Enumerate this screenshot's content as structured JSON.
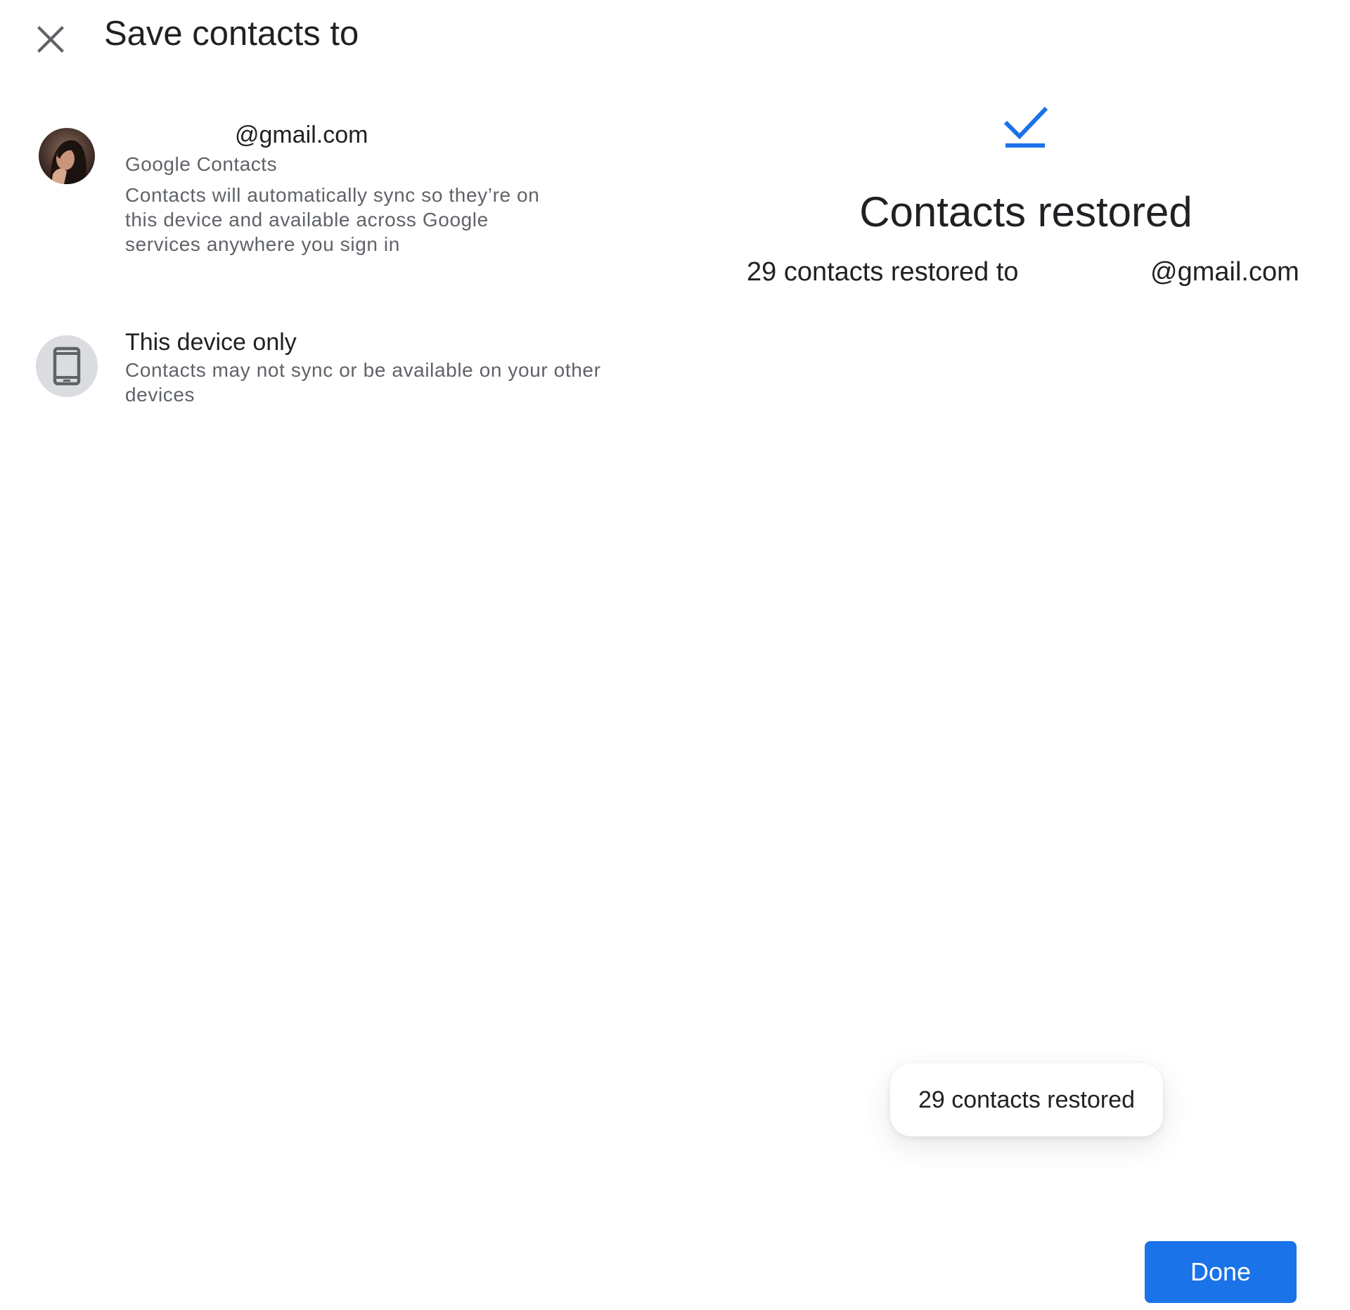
{
  "header": {
    "title": "Save contacts to",
    "close_icon": "close-icon"
  },
  "options": {
    "account": {
      "email": "@gmail.com",
      "service": "Google Contacts",
      "description": "Contacts will automatically sync so they’re on this device and available across Google services anywhere you sign in",
      "icon": "avatar"
    },
    "device": {
      "title": "This device only",
      "description": "Contacts may not sync or be available on your other devices",
      "icon": "phone-icon"
    }
  },
  "result": {
    "icon": "check-icon",
    "heading": "Contacts restored",
    "summary_lead": "29 contacts restored to",
    "summary_email": "@gmail.com"
  },
  "toast": {
    "message": "29 contacts restored"
  },
  "actions": {
    "done_label": "Done"
  },
  "colors": {
    "accent": "#1a73e8",
    "text_primary": "#202124",
    "text_secondary": "#5f6368",
    "device_circle": "#dadce0"
  }
}
